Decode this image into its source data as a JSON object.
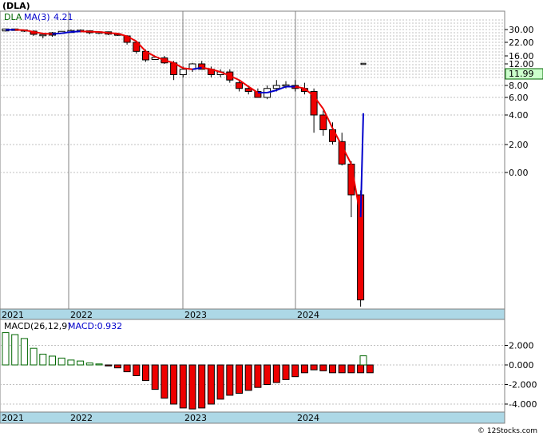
{
  "header": {
    "ticker_title": "(DLA)",
    "legend_symbol": "DLA",
    "legend_ma": "MA(3)",
    "legend_ma_value": "4.21",
    "last_price_badge": "11.99",
    "watermark": "© 12Stocks.com"
  },
  "macd_panel": {
    "label": "MACD(26,12,9)",
    "value_label": "MACD:0.932"
  },
  "colors": {
    "up_candle": "#ffffff",
    "down_candle": "#ee0000",
    "ma_up": "#0000cc",
    "ma_down": "#ee0000",
    "macd_pos": "#006600",
    "macd_neg": "#ee0000",
    "axis_band": "#add8e6",
    "badge_fill": "#ccffcc"
  },
  "chart_data": [
    {
      "type": "candlestick",
      "title": "(DLA)",
      "x_labels": [
        "2021",
        "2022",
        "2023",
        "2024"
      ],
      "y_tick_labels": [
        "30.00",
        "22.00",
        "16.00",
        "12.00",
        "8.00",
        "6.00",
        "4.00",
        "2.00",
        "0.00"
      ],
      "series": [
        {
          "name": "DLA",
          "candles": [
            {
              "o": 29.5,
              "h": 30.5,
              "l": 28.8,
              "c": 30.0
            },
            {
              "o": 30.0,
              "h": 31.0,
              "l": 29.0,
              "c": 29.8
            },
            {
              "o": 29.8,
              "h": 30.2,
              "l": 28.5,
              "c": 29.0
            },
            {
              "o": 29.0,
              "h": 29.5,
              "l": 26.0,
              "c": 27.0
            },
            {
              "o": 26.5,
              "h": 28.0,
              "l": 24.5,
              "c": 26.5
            },
            {
              "o": 26.5,
              "h": 28.5,
              "l": 25.5,
              "c": 28.0
            },
            {
              "o": 28.0,
              "h": 29.0,
              "l": 27.5,
              "c": 28.5
            },
            {
              "o": 28.5,
              "h": 30.0,
              "l": 28.0,
              "c": 29.0
            },
            {
              "o": 29.0,
              "h": 30.0,
              "l": 28.5,
              "c": 29.2
            },
            {
              "o": 29.2,
              "h": 29.5,
              "l": 27.0,
              "c": 28.0
            },
            {
              "o": 28.0,
              "h": 29.0,
              "l": 27.0,
              "c": 28.2
            },
            {
              "o": 28.2,
              "h": 28.8,
              "l": 26.5,
              "c": 27.5
            },
            {
              "o": 27.0,
              "h": 28.0,
              "l": 26.0,
              "c": 26.8
            },
            {
              "o": 26.0,
              "h": 26.5,
              "l": 21.0,
              "c": 22.0
            },
            {
              "o": 22.0,
              "h": 23.0,
              "l": 17.0,
              "c": 18.0
            },
            {
              "o": 18.0,
              "h": 18.8,
              "l": 13.0,
              "c": 14.0
            },
            {
              "o": 14.5,
              "h": 16.0,
              "l": 14.0,
              "c": 15.0
            },
            {
              "o": 15.0,
              "h": 16.0,
              "l": 12.0,
              "c": 12.5
            },
            {
              "o": 12.5,
              "h": 13.5,
              "l": 9.0,
              "c": 10.0
            },
            {
              "o": 10.0,
              "h": 11.5,
              "l": 9.5,
              "c": 11.0
            },
            {
              "o": 11.0,
              "h": 12.5,
              "l": 10.5,
              "c": 12.0
            },
            {
              "o": 12.0,
              "h": 13.5,
              "l": 11.0,
              "c": 11.0
            },
            {
              "o": 11.0,
              "h": 11.5,
              "l": 9.5,
              "c": 10.0
            },
            {
              "o": 10.0,
              "h": 11.0,
              "l": 9.5,
              "c": 10.5
            },
            {
              "o": 10.5,
              "h": 11.0,
              "l": 8.5,
              "c": 9.0
            },
            {
              "o": 8.5,
              "h": 9.0,
              "l": 7.0,
              "c": 7.5
            },
            {
              "o": 7.5,
              "h": 8.0,
              "l": 6.5,
              "c": 7.0
            },
            {
              "o": 7.0,
              "h": 7.5,
              "l": 6.0,
              "c": 6.0
            },
            {
              "o": 6.0,
              "h": 8.0,
              "l": 5.8,
              "c": 7.5
            },
            {
              "o": 7.5,
              "h": 9.0,
              "l": 7.0,
              "c": 8.0
            },
            {
              "o": 8.0,
              "h": 8.8,
              "l": 7.5,
              "c": 8.0
            },
            {
              "o": 8.0,
              "h": 9.0,
              "l": 7.0,
              "c": 7.5
            },
            {
              "o": 7.5,
              "h": 8.5,
              "l": 6.5,
              "c": 7.0
            },
            {
              "o": 7.0,
              "h": 7.5,
              "l": 2.8,
              "c": 4.0
            },
            {
              "o": 4.0,
              "h": 4.5,
              "l": 2.6,
              "c": 3.0
            },
            {
              "o": 3.0,
              "h": 3.5,
              "l": 2.0,
              "c": 2.2
            },
            {
              "o": 2.2,
              "h": 2.8,
              "l": 0.5,
              "c": 0.6
            },
            {
              "o": 0.6,
              "h": 0.8,
              "l": -2.0,
              "c": -1.0
            },
            {
              "o": -1.0,
              "h": -0.8,
              "l": -6.0,
              "c": -5.7
            },
            {
              "o": 12.0,
              "h": 12.0,
              "l": 12.0,
              "c": 12.0
            }
          ]
        },
        {
          "name": "MA(3)",
          "values": [
            29.8,
            29.9,
            29.6,
            28.6,
            27.5,
            27.2,
            27.7,
            28.5,
            28.9,
            28.7,
            28.5,
            27.9,
            27.5,
            25.8,
            22.6,
            18.0,
            15.7,
            13.8,
            12.5,
            11.2,
            11.0,
            11.3,
            11.0,
            10.5,
            9.8,
            9.0,
            7.8,
            6.8,
            6.8,
            7.2,
            7.8,
            7.8,
            7.5,
            6.2,
            4.7,
            3.1,
            1.9,
            0.6,
            -2.0,
            4.2
          ]
        }
      ]
    },
    {
      "type": "bar",
      "title": "MACD(26,12,9)",
      "x_labels": [
        "2021",
        "2022",
        "2023",
        "2024"
      ],
      "y_tick_labels": [
        "2.000",
        "0.000",
        "-2.000",
        "-4.000"
      ],
      "ylim": [
        -4.6,
        4.6
      ],
      "values": [
        3.3,
        3.1,
        2.7,
        1.7,
        1.1,
        0.9,
        0.7,
        0.5,
        0.4,
        0.2,
        0.1,
        -0.1,
        -0.3,
        -0.7,
        -1.1,
        -1.6,
        -2.5,
        -3.4,
        -4.0,
        -4.4,
        -4.5,
        -4.4,
        -4.0,
        -3.5,
        -3.1,
        -2.9,
        -2.6,
        -2.3,
        -2.0,
        -1.8,
        -1.5,
        -1.2,
        -0.8,
        -0.5,
        -0.6,
        -0.8,
        -0.8,
        -0.8,
        -0.8,
        -0.8,
        0.932
      ]
    }
  ]
}
